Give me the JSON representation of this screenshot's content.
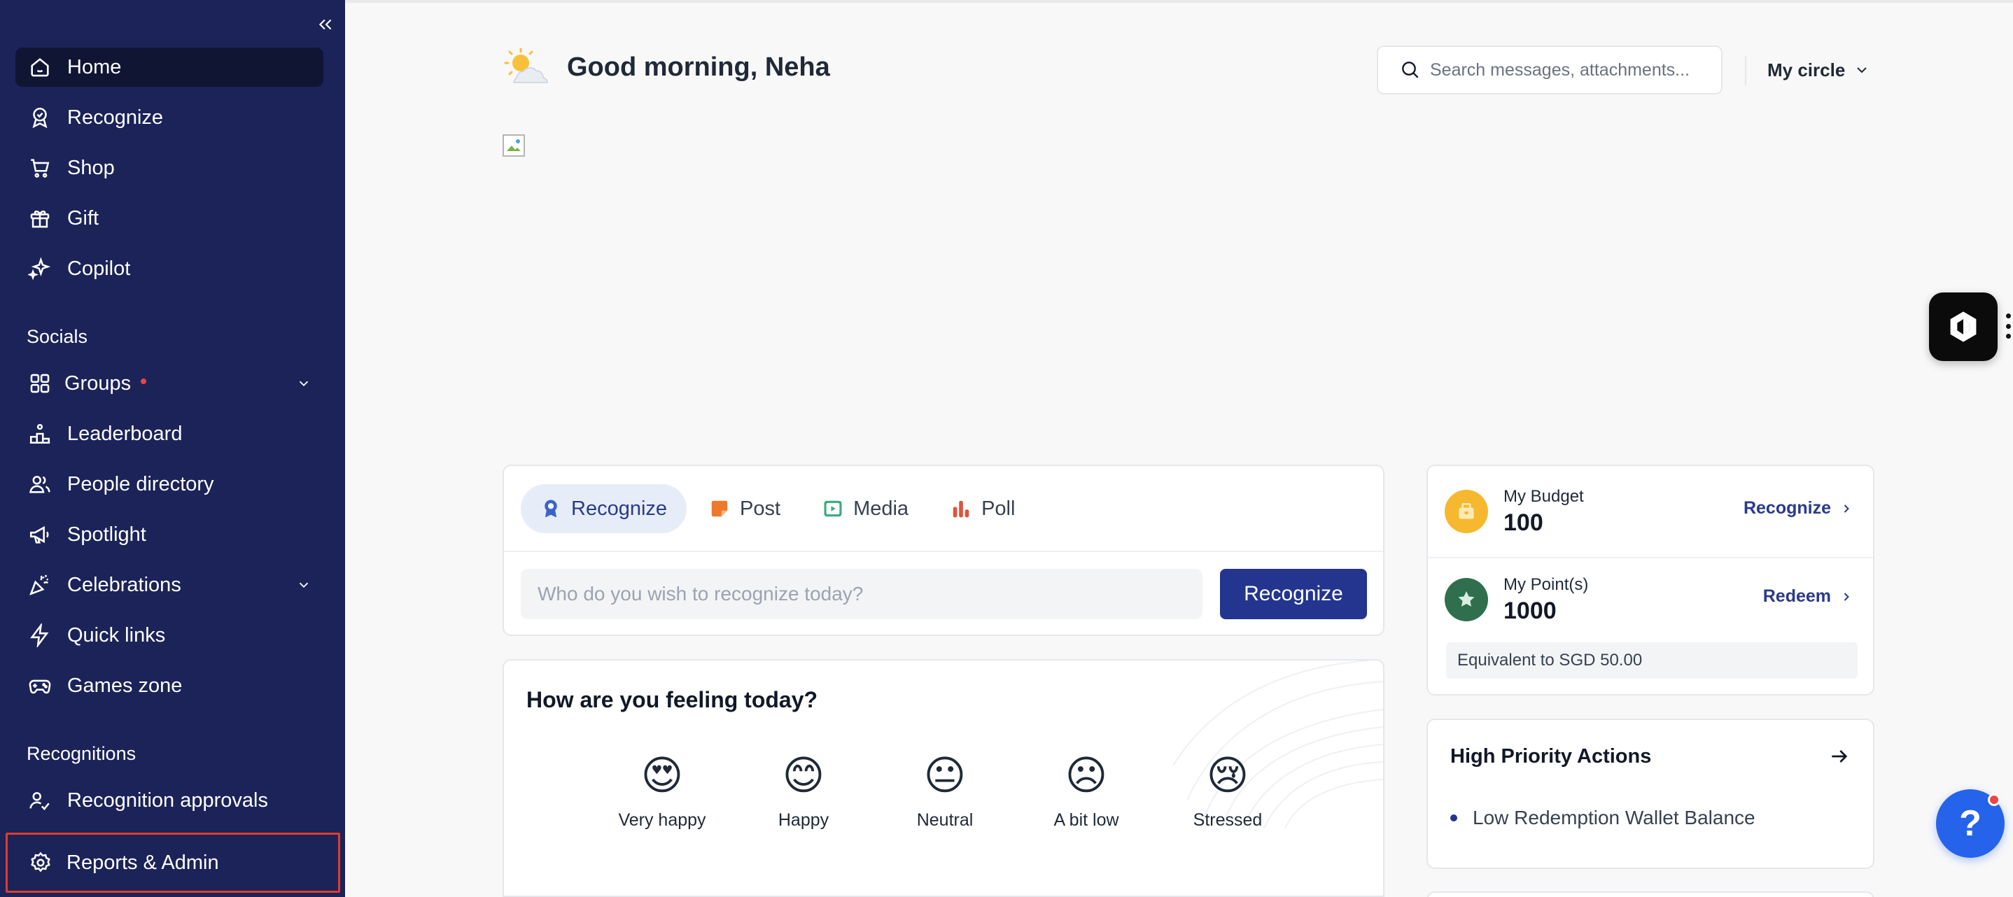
{
  "sidebar": {
    "items": [
      {
        "label": "Home",
        "icon": "home-icon",
        "active": true
      },
      {
        "label": "Recognize",
        "icon": "badge-icon"
      },
      {
        "label": "Shop",
        "icon": "cart-icon"
      },
      {
        "label": "Gift",
        "icon": "gift-icon"
      },
      {
        "label": "Copilot",
        "icon": "sparkle-icon"
      }
    ],
    "socials_heading": "Socials",
    "socials": [
      {
        "label": "Groups",
        "icon": "grid-icon",
        "has_dot": true,
        "expandable": true
      },
      {
        "label": "Leaderboard",
        "icon": "podium-icon"
      },
      {
        "label": "People directory",
        "icon": "people-icon"
      },
      {
        "label": "Spotlight",
        "icon": "megaphone-icon"
      },
      {
        "label": "Celebrations",
        "icon": "party-icon",
        "expandable": true
      },
      {
        "label": "Quick links",
        "icon": "bolt-icon"
      },
      {
        "label": "Games zone",
        "icon": "gamepad-icon"
      }
    ],
    "recognitions_heading": "Recognitions",
    "recognitions": [
      {
        "label": "Recognition approvals",
        "icon": "user-check-icon"
      }
    ],
    "reports_label": "Reports & Admin"
  },
  "header": {
    "greeting": "Good morning, Neha",
    "search_placeholder": "Search messages, attachments...",
    "circle_label": "My circle"
  },
  "compose": {
    "tabs": [
      {
        "label": "Recognize",
        "icon": "ribbon-icon",
        "active": true
      },
      {
        "label": "Post",
        "icon": "note-icon"
      },
      {
        "label": "Media",
        "icon": "play-icon"
      },
      {
        "label": "Poll",
        "icon": "bars-icon"
      }
    ],
    "input_placeholder": "Who do you wish to recognize today?",
    "button_label": "Recognize"
  },
  "mood": {
    "title": "How are you feeling today?",
    "options": [
      {
        "emoji": "😍",
        "label": "Very happy"
      },
      {
        "emoji": "😊",
        "label": "Happy"
      },
      {
        "emoji": "😐",
        "label": "Neutral"
      },
      {
        "emoji": "☹",
        "label": "A bit low"
      },
      {
        "emoji": "😢",
        "label": "Stressed"
      }
    ]
  },
  "wallet": {
    "budget_label": "My Budget",
    "budget_value": "100",
    "budget_action": "Recognize",
    "points_label": "My Point(s)",
    "points_value": "1000",
    "points_action": "Redeem",
    "equivalent": "Equivalent to SGD 50.00"
  },
  "actions": {
    "title": "High Priority Actions",
    "items": [
      "Low Redemption Wallet Balance"
    ]
  },
  "help": {
    "label": "?"
  },
  "colors": {
    "sidebar_bg": "#1b2358",
    "primary": "#23358f",
    "budget_icon_bg": "#f5b82e",
    "points_icon_bg": "#2f6f4e",
    "alert": "#ef4444",
    "help_bg": "#2563eb"
  }
}
